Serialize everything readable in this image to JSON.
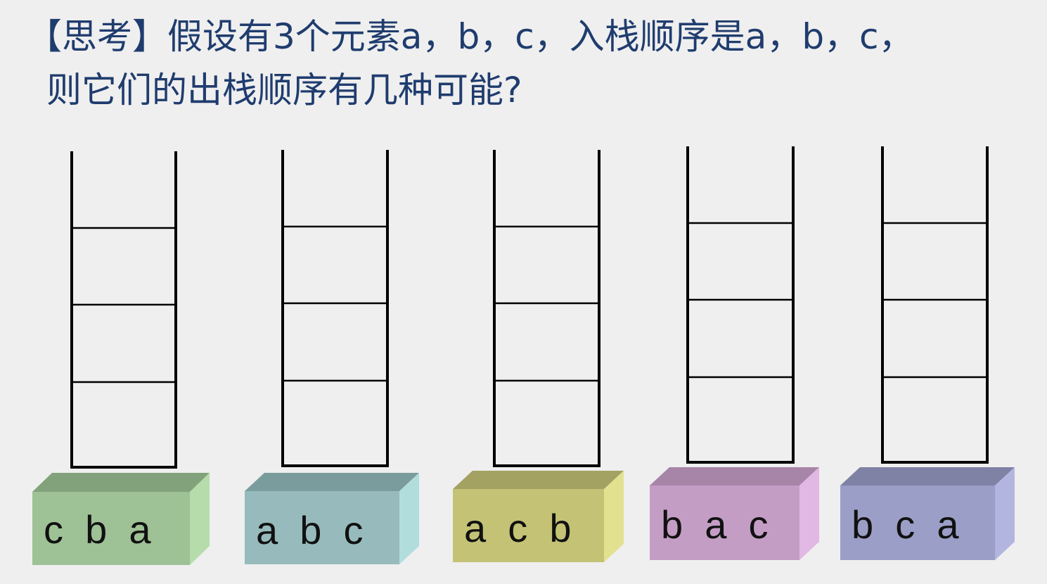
{
  "question": {
    "line1": "【思考】假设有3个元素a，b，c，入栈顺序是a，b，c，",
    "line2": "则它们的出栈顺序有几种可能?"
  },
  "stacks": [
    {
      "label": "c b a",
      "colors": {
        "front": "#9ec196",
        "top": "#82a27b",
        "side": "#b5dcaa"
      }
    },
    {
      "label": "a b c",
      "colors": {
        "front": "#97bbbc",
        "top": "#7b9c9d",
        "side": "#b2dddd"
      }
    },
    {
      "label": "a c b",
      "colors": {
        "front": "#c4c275",
        "top": "#a4a262",
        "side": "#e2e190"
      }
    },
    {
      "label": "b a c",
      "colors": {
        "front": "#c49dc5",
        "top": "#a785a8",
        "side": "#e1b8e3"
      }
    },
    {
      "label": "b c a",
      "colors": {
        "front": "#9b9ec6",
        "top": "#7f82a5",
        "side": "#b3b5e1"
      }
    }
  ]
}
